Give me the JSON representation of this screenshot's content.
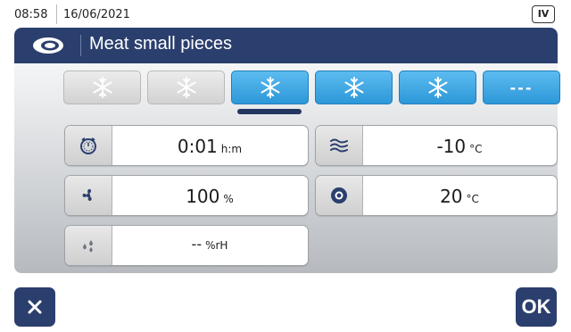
{
  "status": {
    "time": "08:58",
    "date": "16/06/2021",
    "badge": "IV"
  },
  "program": {
    "title": "Meat small pieces",
    "icon": "meat-icon"
  },
  "phases": [
    {
      "icon": "snowflake-icon",
      "state": "inactive"
    },
    {
      "icon": "snowflake-icon",
      "state": "inactive"
    },
    {
      "icon": "snowflake-icon",
      "state": "selected"
    },
    {
      "icon": "snowflake-icon",
      "state": "active"
    },
    {
      "icon": "snowflake-icon",
      "state": "active"
    },
    {
      "label": "---",
      "state": "active"
    }
  ],
  "params": {
    "time": {
      "icon": "timer-icon",
      "value": "0:01",
      "unit": "h:m"
    },
    "fan": {
      "icon": "fan-icon",
      "value": "100",
      "unit": "%"
    },
    "humidity": {
      "icon": "humidity-icon",
      "value": "--",
      "unit": "%rH"
    },
    "air_temp": {
      "icon": "air-temperature-icon",
      "value": "-10",
      "unit": "°C"
    },
    "core_temp": {
      "icon": "core-probe-icon",
      "value": "20",
      "unit": "°C"
    }
  },
  "buttons": {
    "cancel_icon": "close-icon",
    "ok_label": "OK"
  },
  "colors": {
    "navy": "#2b3f6e",
    "phase_active": "#3aa5e3",
    "phase_inactive": "#d6d6d6"
  }
}
